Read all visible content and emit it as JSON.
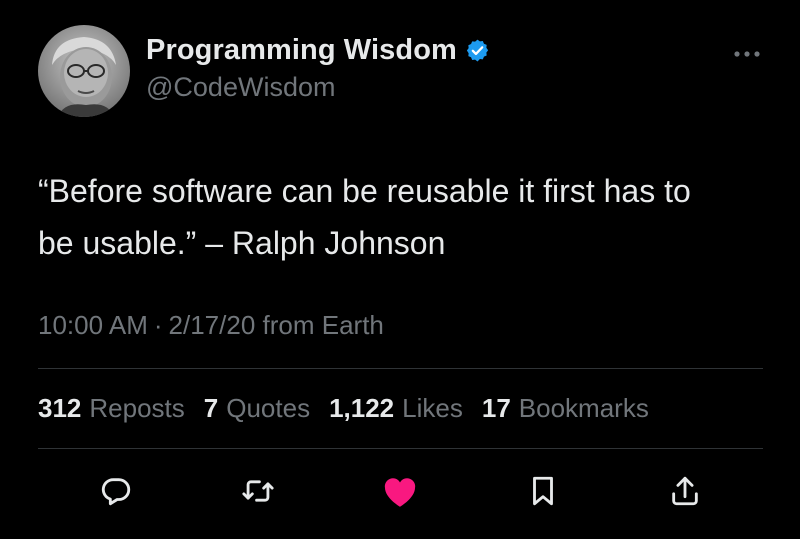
{
  "author": {
    "display_name": "Programming Wisdom",
    "handle": "@CodeWisdom",
    "verified": true,
    "verified_color": "#1d9bf0"
  },
  "tweet": {
    "text_line1": "“Before software can be reusable it first has to",
    "text_line2": "be usable.” – Ralph Johnson",
    "time": "10:00 AM",
    "separator": "·",
    "date": "2/17/20",
    "source": "from Earth"
  },
  "stats": [
    {
      "count": "312",
      "label": "Reposts"
    },
    {
      "count": "7",
      "label": "Quotes"
    },
    {
      "count": "1,122",
      "label": "Likes"
    },
    {
      "count": "17",
      "label": "Bookmarks"
    }
  ],
  "actions": [
    {
      "name": "reply",
      "icon": "speech-bubble-icon"
    },
    {
      "name": "repost",
      "icon": "repost-arrows-icon"
    },
    {
      "name": "like",
      "icon": "heart-icon",
      "active": true,
      "color": "#f91880"
    },
    {
      "name": "bookmark",
      "icon": "bookmark-icon"
    },
    {
      "name": "share",
      "icon": "share-upload-icon"
    }
  ],
  "colors": {
    "background": "#000000",
    "primary_text": "#e7e9ea",
    "secondary_text": "#71767b",
    "divider": "#2f3336",
    "like_active": "#f91880"
  }
}
